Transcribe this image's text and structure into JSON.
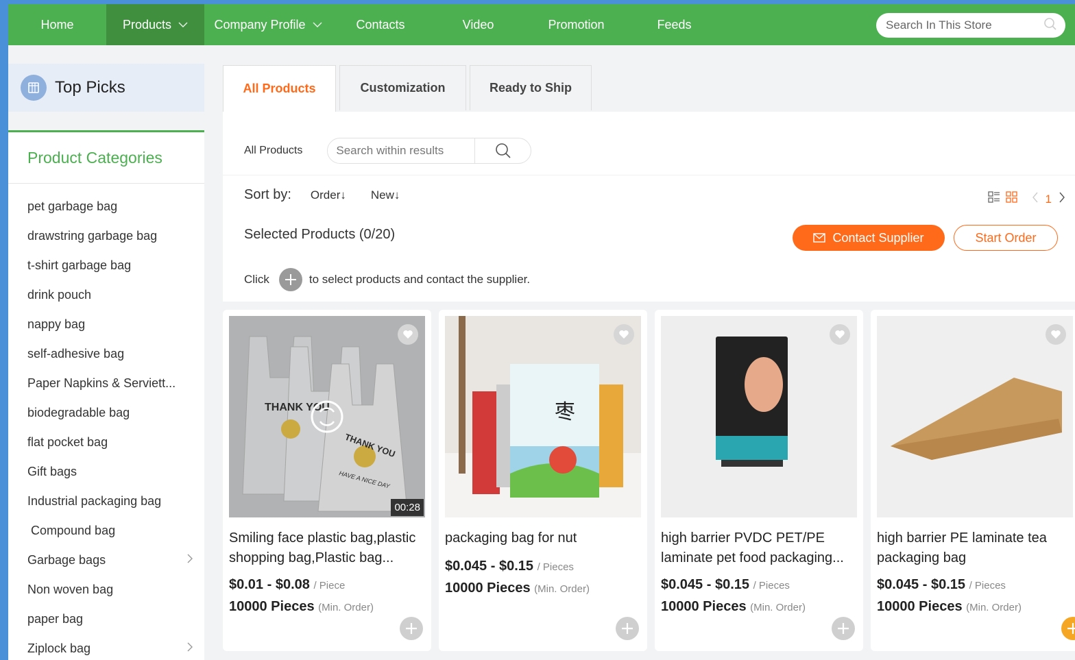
{
  "nav": {
    "items": [
      {
        "label": "Home"
      },
      {
        "label": "Products"
      },
      {
        "label": "Company Profile"
      },
      {
        "label": "Contacts"
      },
      {
        "label": "Video"
      },
      {
        "label": "Promotion"
      },
      {
        "label": "Feeds"
      }
    ],
    "search_placeholder": "Search In This Store"
  },
  "sidebar": {
    "top_picks_label": "Top Picks",
    "categories_title": "Product Categories",
    "categories": [
      {
        "label": "pet garbage bag"
      },
      {
        "label": "drawstring garbage bag"
      },
      {
        "label": "t-shirt garbage bag"
      },
      {
        "label": "drink pouch"
      },
      {
        "label": "nappy bag"
      },
      {
        "label": "self-adhesive bag"
      },
      {
        "label": "Paper Napkins & Serviett..."
      },
      {
        "label": "biodegradable bag"
      },
      {
        "label": "flat pocket bag"
      },
      {
        "label": "Gift bags"
      },
      {
        "label": "Industrial packaging bag"
      },
      {
        "label": " Compound bag"
      },
      {
        "label": "Garbage bags"
      },
      {
        "label": "Non woven bag"
      },
      {
        "label": "paper bag"
      },
      {
        "label": "Ziplock bag"
      }
    ]
  },
  "tabs": [
    {
      "label": "All Products"
    },
    {
      "label": "Customization"
    },
    {
      "label": "Ready to Ship"
    }
  ],
  "filter": {
    "label": "All Products",
    "search_placeholder": "Search within results"
  },
  "sort": {
    "label": "Sort by:",
    "options": [
      "Order↓",
      "New↓"
    ],
    "page": "1"
  },
  "selection": {
    "text": "Selected Products (0/20)",
    "contact_label": "Contact Supplier",
    "start_label": "Start Order",
    "hint_prefix": "Click",
    "hint_suffix": "to select products and contact the supplier."
  },
  "products": [
    {
      "title": "Smiling face plastic bag,plastic shopping bag,Plastic bag...",
      "price": "$0.01 - $0.08",
      "price_unit": "/ Piece",
      "moq": "10000 Pieces",
      "moq_note": "(Min. Order)",
      "video_duration": "00:28",
      "bag_text_1": "THANK YOU",
      "bag_text_2": "HAVE A NICE DAY"
    },
    {
      "title": "packaging bag for nut",
      "price": "$0.045 - $0.15",
      "price_unit": "/ Pieces",
      "moq": "10000 Pieces",
      "moq_note": "(Min. Order)"
    },
    {
      "title": "high barrier PVDC PET/PE laminate pet food packaging...",
      "price": "$0.045 - $0.15",
      "price_unit": "/ Pieces",
      "moq": "10000 Pieces",
      "moq_note": "(Min. Order)"
    },
    {
      "title": "high barrier PE laminate tea packaging bag",
      "price": "$0.045 - $0.15",
      "price_unit": "/ Pieces",
      "moq": "10000 Pieces",
      "moq_note": "(Min. Order)"
    }
  ],
  "colors": {
    "nav_green": "#4caf50",
    "accent_orange": "#ff6a1a"
  }
}
